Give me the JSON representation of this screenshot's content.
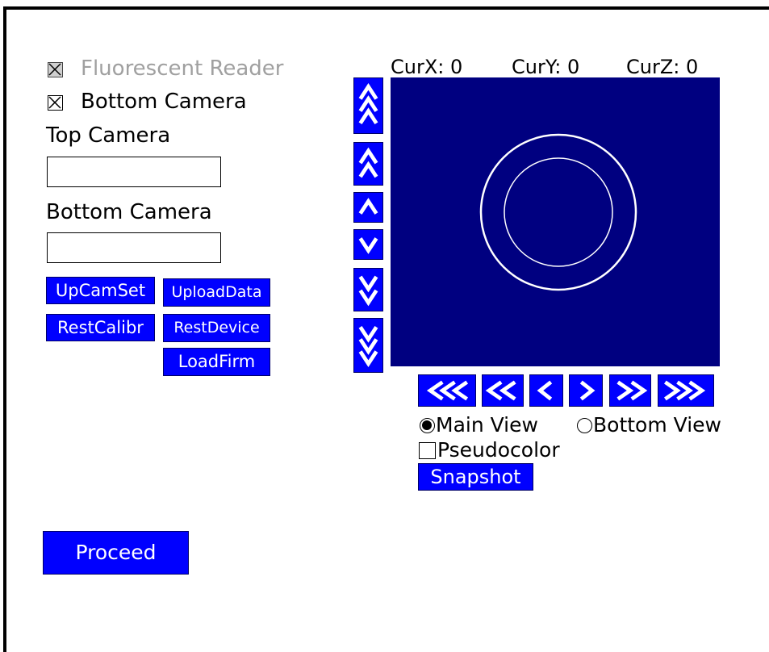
{
  "checkboxes": {
    "fluorescent": {
      "label": "Fluorescent Reader",
      "checked": true,
      "disabled": true
    },
    "bottom_camera": {
      "label": "Bottom Camera",
      "checked": true
    }
  },
  "fields": {
    "top_camera": {
      "label": "Top Camera",
      "value": ""
    },
    "bottom_camera": {
      "label": "Bottom Camera",
      "value": ""
    }
  },
  "buttons": {
    "upcamset": "UpCamSet",
    "uploaddata": "UploadData",
    "restcalibr": "RestCalibr",
    "restdevice": "RestDevice",
    "loadfirm": "LoadFirm",
    "proceed": "Proceed",
    "snapshot": "Snapshot"
  },
  "coords": {
    "x": "CurX: 0",
    "y": "CurY: 0",
    "z": "CurZ: 0"
  },
  "view_options": {
    "main_view": {
      "label": "Main View",
      "selected": true
    },
    "bottom_view": {
      "label": "Bottom View",
      "selected": false
    },
    "pseudocolor": {
      "label": "Pseudocolor",
      "checked": false
    }
  },
  "icons": {
    "vertical": [
      "triple-up-arrow-icon",
      "double-up-arrow-icon",
      "up-arrow-icon",
      "down-arrow-icon",
      "double-down-arrow-icon",
      "triple-down-arrow-icon"
    ],
    "horizontal": [
      "triple-left-arrow-icon",
      "double-left-arrow-icon",
      "left-arrow-icon",
      "right-arrow-icon",
      "double-right-arrow-icon",
      "triple-right-arrow-icon"
    ]
  },
  "colors": {
    "button": "#0000ff",
    "view": "#000080",
    "disabled_text": "#a0a0a0"
  }
}
